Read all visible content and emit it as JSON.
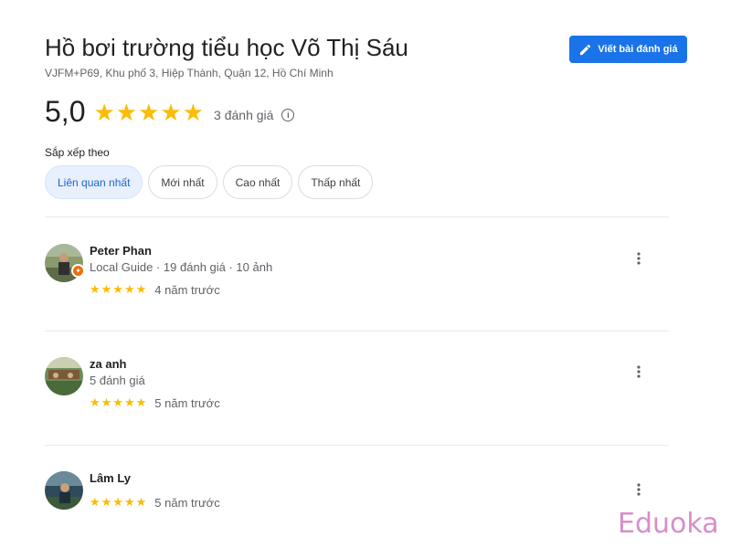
{
  "place": {
    "title": "Hồ bơi trường tiểu học Võ Thị Sáu",
    "address": "VJFM+P69, Khu phố 3, Hiệp Thành, Quận 12, Hồ Chí Minh"
  },
  "write_review_button": {
    "label": "Viết bài đánh giá",
    "icon": "pencil-icon"
  },
  "rating": {
    "score": "5,0",
    "stars": "★★★★★",
    "count_label": "3 đánh giá",
    "info_icon": "info-icon"
  },
  "sort": {
    "label": "Sắp xếp theo",
    "options": [
      "Liên quan nhất",
      "Mới nhất",
      "Cao nhất",
      "Thấp nhất"
    ],
    "selected": "Liên quan nhất"
  },
  "reviews": [
    {
      "name": "Peter Phan",
      "meta": "Local Guide · 19 đánh giá · 10 ảnh",
      "stars": "★★★★★",
      "rating": 5,
      "date": "4 năm trước",
      "local_guide_badge": true
    },
    {
      "name": "za anh",
      "meta": "5 đánh giá",
      "stars": "★★★★★",
      "rating": 5,
      "date": "5 năm trước",
      "local_guide_badge": false
    },
    {
      "name": "Lâm Ly",
      "meta": "",
      "stars": "★★★★★",
      "rating": 5,
      "date": "5 năm trước",
      "local_guide_badge": false
    }
  ],
  "more_icon": "more-vert-icon",
  "watermark": "Eduoka",
  "colors": {
    "accent": "#1a73e8",
    "star": "#fbbc04",
    "chip_active_bg": "#e8f0fe",
    "watermark": "#d58fcb"
  }
}
